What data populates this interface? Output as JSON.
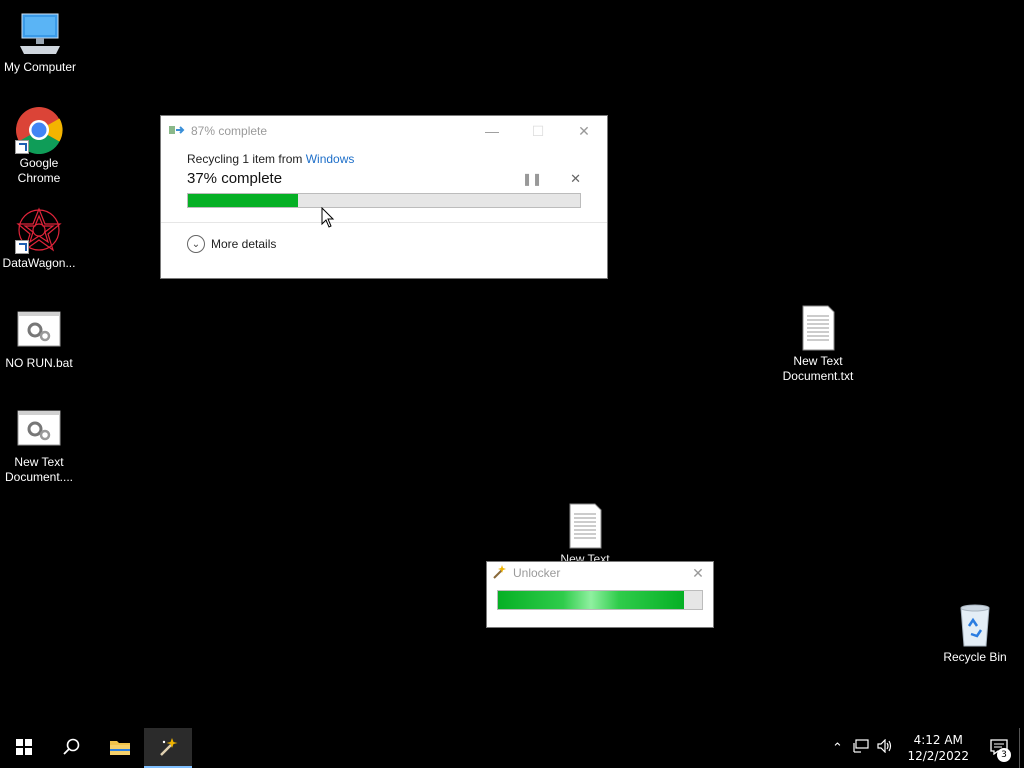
{
  "desktop": {
    "icons": [
      {
        "label": "My Computer",
        "icon": "computer-icon"
      },
      {
        "label": "Google Chrome",
        "icon": "chrome-icon"
      },
      {
        "label": "DataWagon...",
        "icon": "datawagon-icon"
      },
      {
        "label": "NO RUN.bat",
        "icon": "batch-file-icon"
      },
      {
        "label": "New Text Document....",
        "icon": "batch-file-icon"
      },
      {
        "label": "New Text Document.txt",
        "icon": "text-file-icon"
      },
      {
        "label": "New Text",
        "icon": "text-file-icon"
      },
      {
        "label": "Recycle Bin",
        "icon": "recycle-bin-icon"
      }
    ]
  },
  "copy_dialog": {
    "title": "87% complete",
    "recycle_prefix": "Recycling 1 item from ",
    "recycle_source": "Windows",
    "percent_text": "37% complete",
    "progress": 0.28,
    "more_details": "More details",
    "accent": "#06b025"
  },
  "unlocker_dialog": {
    "title": "Unlocker",
    "progress": 0.91
  },
  "taskbar": {
    "time": "4:12 AM",
    "date": "12/2/2022",
    "notification_count": "3"
  }
}
